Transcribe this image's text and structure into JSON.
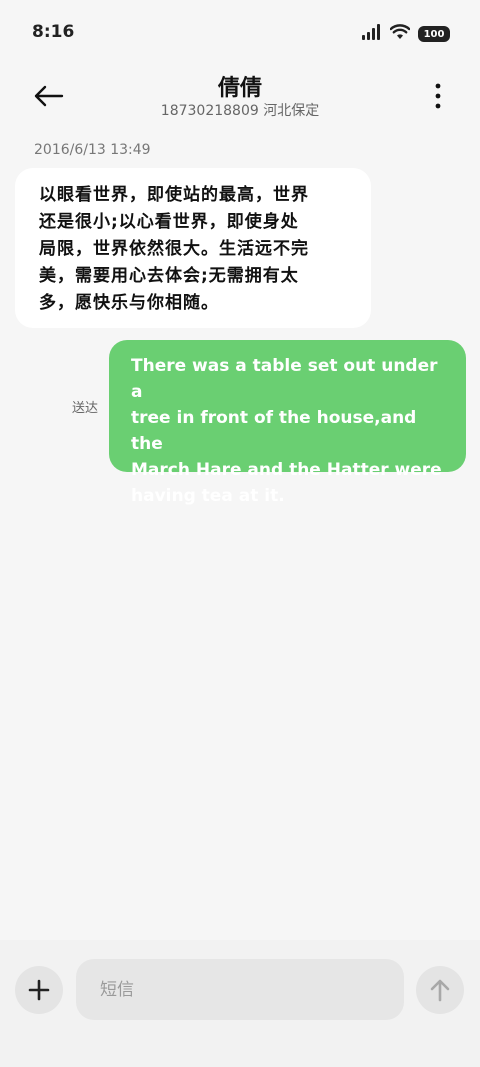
{
  "status_bar": {
    "time": "8:16",
    "battery": "100",
    "icons": [
      "signal-icon",
      "wifi-icon",
      "battery-icon"
    ]
  },
  "header": {
    "back_icon": "back-arrow-icon",
    "contact_name": "倩倩",
    "contact_sub": "18730218809 河北保定",
    "more_icon": "more-vertical-icon"
  },
  "messages": {
    "timestamp": "2016/6/13 13:49",
    "incoming": {
      "lines": [
        "以眼看世界，即使站的最高，世界",
        "还是很小;以心看世界，即使身处",
        "局限，世界依然很大。生活远不完",
        "美，需要用心去体会;无需拥有太",
        "多，愿快乐与你相随。"
      ]
    },
    "outgoing": {
      "status": "送达",
      "lines": [
        "There was a table set out under a",
        "tree in front of the house,and the",
        "March Hare and the Hatter were",
        "having tea at it."
      ]
    }
  },
  "composer": {
    "add_icon": "plus-icon",
    "placeholder": "短信",
    "send_icon": "send-arrow-up-icon"
  },
  "colors": {
    "background": "#f6f6f6",
    "incoming_bubble": "#ffffff",
    "outgoing_bubble": "#6acf72"
  }
}
